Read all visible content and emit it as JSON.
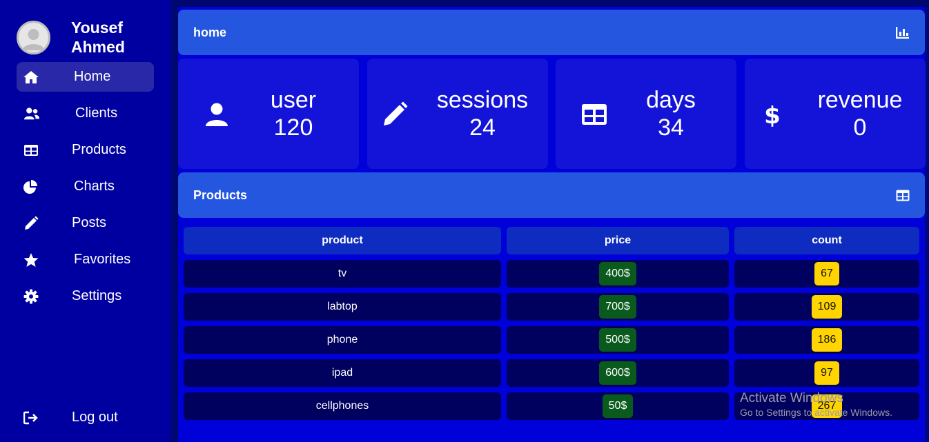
{
  "user": {
    "name": "Yousef Ahmed"
  },
  "sidebar": {
    "items": [
      {
        "label": "Home",
        "icon": "home-icon",
        "active": true
      },
      {
        "label": "Clients",
        "icon": "users-icon"
      },
      {
        "label": "Products",
        "icon": "table-icon"
      },
      {
        "label": "Charts",
        "icon": "pie-chart-icon"
      },
      {
        "label": "Posts",
        "icon": "pencil-icon"
      },
      {
        "label": "Favorites",
        "icon": "star-icon"
      },
      {
        "label": "Settings",
        "icon": "gear-icon"
      }
    ],
    "logout_label": "Log out"
  },
  "header": {
    "title": "home",
    "icon": "bar-chart-icon"
  },
  "cards": [
    {
      "label": "user",
      "value": "120",
      "icon": "user-icon"
    },
    {
      "label": "sessions",
      "value": "24",
      "icon": "pencil-icon"
    },
    {
      "label": "days",
      "value": "34",
      "icon": "table-icon"
    },
    {
      "label": "revenue",
      "value": "0",
      "icon": "dollar-icon"
    }
  ],
  "products_section": {
    "title": "Products",
    "icon": "table-icon"
  },
  "table": {
    "columns": [
      "product",
      "price",
      "count"
    ],
    "rows": [
      {
        "product": "tv",
        "price": "400$",
        "count": "67"
      },
      {
        "product": "labtop",
        "price": "700$",
        "count": "109"
      },
      {
        "product": "phone",
        "price": "500$",
        "count": "186"
      },
      {
        "product": "ipad",
        "price": "600$",
        "count": "97"
      },
      {
        "product": "cellphones",
        "price": "50$",
        "count": "267"
      }
    ]
  },
  "watermark": {
    "line1": "Activate Windows",
    "line2": "Go to Settings to activate Windows."
  },
  "colors": {
    "sidebar_bg": "#0000a0",
    "main_bg": "#0000d8",
    "header_bg": "#2456e0",
    "card_bg": "#1414d8",
    "price_badge": "#0a5a1e",
    "count_badge": "#ffd400"
  }
}
